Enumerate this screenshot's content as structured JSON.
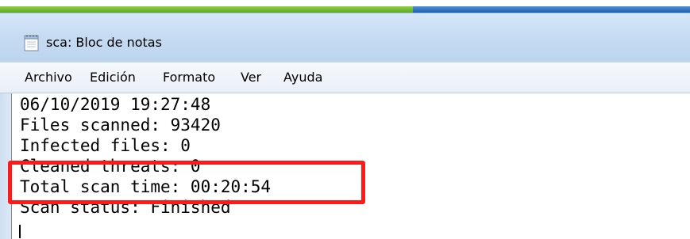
{
  "window": {
    "title": "sca: Bloc de notas",
    "app_icon": "notepad-icon"
  },
  "menu": {
    "items": [
      {
        "label": "Archivo"
      },
      {
        "label": "Edición"
      },
      {
        "label": "Formato"
      },
      {
        "label": "Ver"
      },
      {
        "label": "Ayuda"
      }
    ]
  },
  "document": {
    "lines": [
      "06/10/2019 19:27:48",
      "Files scanned: 93420",
      "Infected files: 0",
      "Cleaned threats: 0",
      "Total scan time: 00:20:54",
      "Scan status: Finished"
    ]
  },
  "colors": {
    "highlight_border": "#ff1a1a",
    "taskbar_green": "#6db52f",
    "taskbar_blue": "#2a6fc4"
  }
}
